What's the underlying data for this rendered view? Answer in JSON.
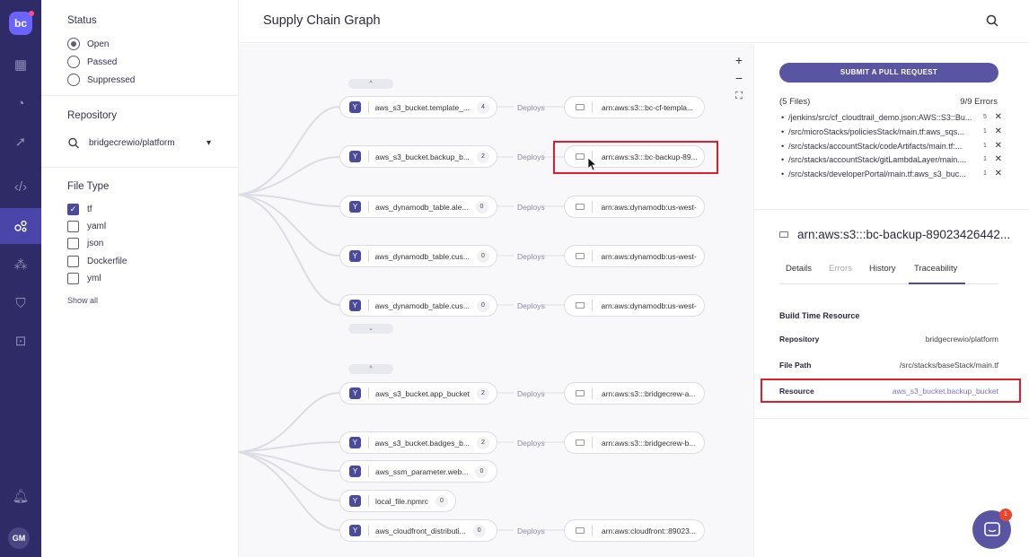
{
  "app": {
    "logo": "bc",
    "avatar": "GM"
  },
  "rail": {
    "icons": [
      "dashboard-icon",
      "incidents-icon",
      "launch-icon",
      "code-icon",
      "graph-icon",
      "resources-icon",
      "shield-icon",
      "integrations-icon"
    ],
    "bottom_icon": "bell-icon",
    "active": "graph-icon"
  },
  "filters": {
    "status_title": "Status",
    "status_options": [
      {
        "label": "Open",
        "selected": true
      },
      {
        "label": "Passed",
        "selected": false
      },
      {
        "label": "Suppressed",
        "selected": false
      }
    ],
    "repository_title": "Repository",
    "repository_value": "bridgecrewio/platform",
    "filetype_title": "File Type",
    "filetypes": [
      {
        "label": "tf",
        "checked": true
      },
      {
        "label": "yaml",
        "checked": false
      },
      {
        "label": "json",
        "checked": false
      },
      {
        "label": "Dockerfile",
        "checked": false
      },
      {
        "label": "yml",
        "checked": false
      }
    ],
    "show_all": "Show all"
  },
  "header": {
    "title": "Supply Chain Graph"
  },
  "graph": {
    "zoom_in": "+",
    "zoom_out": "−",
    "fit": "⛶",
    "collapse_up": "^",
    "collapse_down": "⌄",
    "edge_label": "Deploys",
    "nodes": [
      {
        "label": "aws_s3_bucket.template_...",
        "count": "4",
        "target": "arn:aws:s3:::bc-cf-templa..."
      },
      {
        "label": "aws_s3_bucket.backup_b...",
        "count": "2",
        "target": "arn:aws:s3:::bc-backup-89..."
      },
      {
        "label": "aws_dynamodb_table.ale...",
        "count": "0",
        "target": "arn:aws:dynamodb:us-west-..."
      },
      {
        "label": "aws_dynamodb_table.cus...",
        "count": "0",
        "target": "arn:aws:dynamodb:us-west-..."
      },
      {
        "label": "aws_dynamodb_table.cus...",
        "count": "0",
        "target": "arn:aws:dynamodb:us-west-..."
      },
      {
        "label": "aws_s3_bucket.app_bucket",
        "count": "2",
        "target": "arn:aws:s3:::bridgecrew-a..."
      },
      {
        "label": "aws_s3_bucket.badges_b...",
        "count": "2",
        "target": "arn:aws:s3:::bridgecrew-b..."
      },
      {
        "label": "aws_ssm_parameter.web...",
        "count": "0",
        "target": ""
      },
      {
        "label": "local_file.npmrc",
        "count": "0",
        "target": ""
      },
      {
        "label": "aws_cloudfront_distributi...",
        "count": "0",
        "target": "arn:aws:cloudfront::89023..."
      }
    ]
  },
  "panel": {
    "pr_button": "SUBMIT A PULL REQUEST",
    "files_count": "(5 Files)",
    "errors": "9/9 Errors",
    "files": [
      {
        "path": "/jenkins/src/cf_cloudtrail_demo.json:AWS::S3::Bu...",
        "count": "5"
      },
      {
        "path": "/src/microStacks/policiesStack/main.tf:aws_sqs...",
        "count": "1"
      },
      {
        "path": "/src/stacks/accountStack/codeArtifacts/main.tf:...",
        "count": "1"
      },
      {
        "path": "/src/stacks/accountStack/gitLambdaLayer/main....",
        "count": "1"
      },
      {
        "path": "/src/stacks/developerPortal/main.tf:aws_s3_buc...",
        "count": "1"
      }
    ],
    "resource_title": "arn:aws:s3:::bc-backup-89023426442...",
    "tabs": [
      "Details",
      "Errors",
      "History",
      "Traceability"
    ],
    "section_title": "Build Time Resource",
    "repository_label": "Repository",
    "repository_value": "bridgecrewio/platform",
    "filepath_label": "File Path",
    "filepath_value": "/src/stacks/baseStack/main.tf",
    "resource_label": "Resource",
    "resource_value": "aws_s3_bucket.backup_bucket",
    "chat_badge": "1"
  }
}
